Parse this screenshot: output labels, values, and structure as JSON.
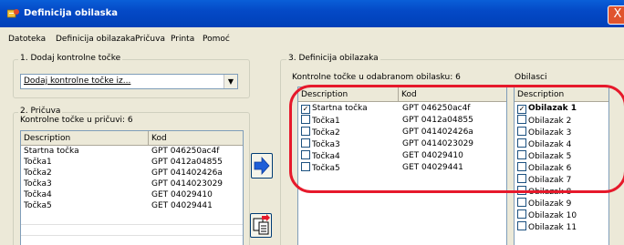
{
  "window": {
    "title": "Definicija obilaska",
    "close_glyph": "X"
  },
  "menu": [
    "Datoteka",
    "Definicija obilazaka",
    "Pričuva",
    "Printa",
    "Pomoć"
  ],
  "section1": {
    "title": "1. Dodaj kontrolne točke",
    "combo_value": "Dodaj kontrolne točke iz..."
  },
  "section2": {
    "title": "2. Pričuva",
    "count_label": "Kontrolne točke u pričuvi: 6",
    "columns": [
      "Description",
      "Kod"
    ],
    "rows": [
      [
        "Startna točka",
        "GPT 046250ac4f"
      ],
      [
        "Točka1",
        "GPT 0412a04855"
      ],
      [
        "Točka2",
        "GPT 041402426a"
      ],
      [
        "Točka3",
        "GPT 0414023029"
      ],
      [
        "Točka4",
        "GET 04029410"
      ],
      [
        "Točka5",
        "GET 04029441"
      ]
    ]
  },
  "section3": {
    "title": "3. Definicija obilazaka",
    "count_label": "Kontrolne točke u odabranom obilasku: 6",
    "obilasci_label": "Obilasci",
    "columns": [
      "Description",
      "Kod"
    ],
    "rows": [
      [
        "Startna točka",
        "GPT 046250ac4f",
        true
      ],
      [
        "Točka1",
        "GPT 0412a04855",
        false
      ],
      [
        "Točka2",
        "GPT 041402426a",
        false
      ],
      [
        "Točka3",
        "GPT 0414023029",
        false
      ],
      [
        "Točka4",
        "GET 04029410",
        false
      ],
      [
        "Točka5",
        "GET 04029441",
        false
      ]
    ],
    "obilasci_column": "Description",
    "obilasci": [
      [
        "Obilazak 1",
        true
      ],
      [
        "Obilazak 2",
        false
      ],
      [
        "Obilazak 3",
        false
      ],
      [
        "Obilazak 4",
        false
      ],
      [
        "Obilazak 5",
        false
      ],
      [
        "Obilazak 6",
        false
      ],
      [
        "Obilazak 7",
        false
      ],
      [
        "Obilazak 8",
        false
      ],
      [
        "Obilazak 9",
        false
      ],
      [
        "Obilazak 10",
        false
      ],
      [
        "Obilazak 11",
        false
      ]
    ]
  },
  "colors": {
    "title_bar": "#0449c6",
    "highlight": "#e6192b",
    "arrow": "#1f5fd8"
  },
  "icons": [
    "app-icon",
    "close-icon",
    "dropdown-arrow-icon",
    "move-right-arrow-icon",
    "copy-document-icon",
    "checkbox-icon"
  ]
}
